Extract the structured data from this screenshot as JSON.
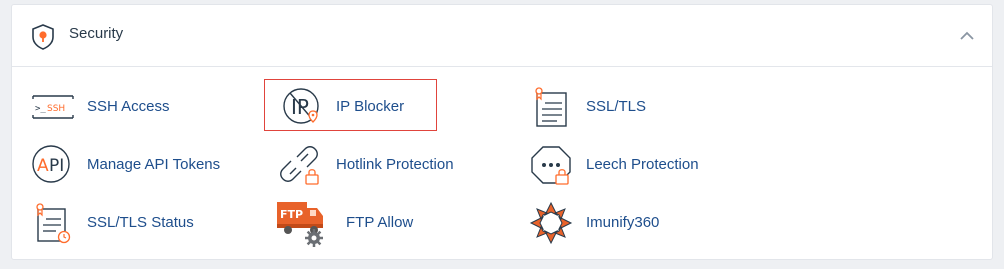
{
  "section": {
    "title": "Security",
    "header_icon": "shield-icon",
    "collapse_icon": "chevron-up-icon"
  },
  "items": [
    {
      "label": "SSH Access",
      "icon": "ssh-terminal-icon"
    },
    {
      "label": "IP Blocker",
      "icon": "ip-blocker-icon"
    },
    {
      "label": "SSL/TLS",
      "icon": "ssl-certificate-icon"
    },
    {
      "label": "Manage API Tokens",
      "icon": "api-icon"
    },
    {
      "label": "Hotlink Protection",
      "icon": "broken-link-icon"
    },
    {
      "label": "Leech Protection",
      "icon": "leech-protection-icon"
    },
    {
      "label": "SSL/TLS Status",
      "icon": "ssl-status-icon"
    },
    {
      "label": "FTP Allow",
      "icon": "ftp-truck-icon"
    },
    {
      "label": "Imunify360",
      "icon": "imunify360-icon"
    }
  ],
  "colors": {
    "link": "#1e4e8c",
    "accent": "#ff6c2c",
    "highlight_border": "#e0443c",
    "icon_stroke": "#293a4a"
  }
}
